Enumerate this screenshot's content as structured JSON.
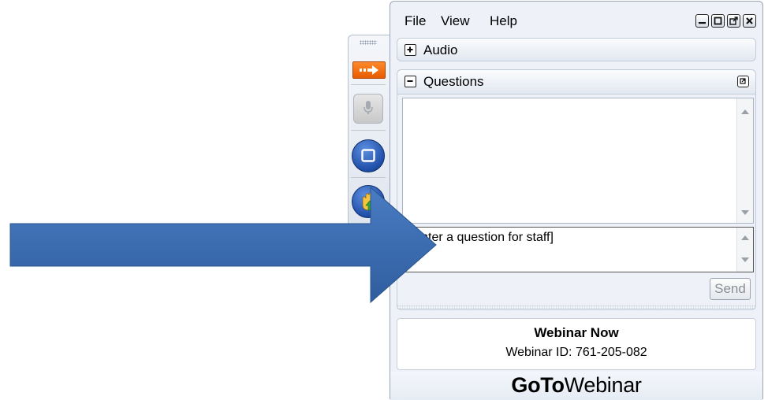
{
  "menu": {
    "file": "File",
    "view": "View",
    "help": "Help"
  },
  "window_buttons": [
    "minimize-icon",
    "restore-icon",
    "popout-icon",
    "close-icon"
  ],
  "audio": {
    "label": "Audio",
    "toggle": "+"
  },
  "questions": {
    "label": "Questions",
    "toggle": "−",
    "input_value": "[Enter a question for staff]",
    "send_label": "Send"
  },
  "webinar": {
    "title": "Webinar Now",
    "id_text": "Webinar ID: 761-205-082"
  },
  "brand": {
    "bold": "GoTo",
    "regular": "Webinar"
  },
  "colors": {
    "accent_orange": "#ff6a00",
    "button_blue": "#2a5cb8",
    "arrow_blue": "#3a6db3"
  }
}
